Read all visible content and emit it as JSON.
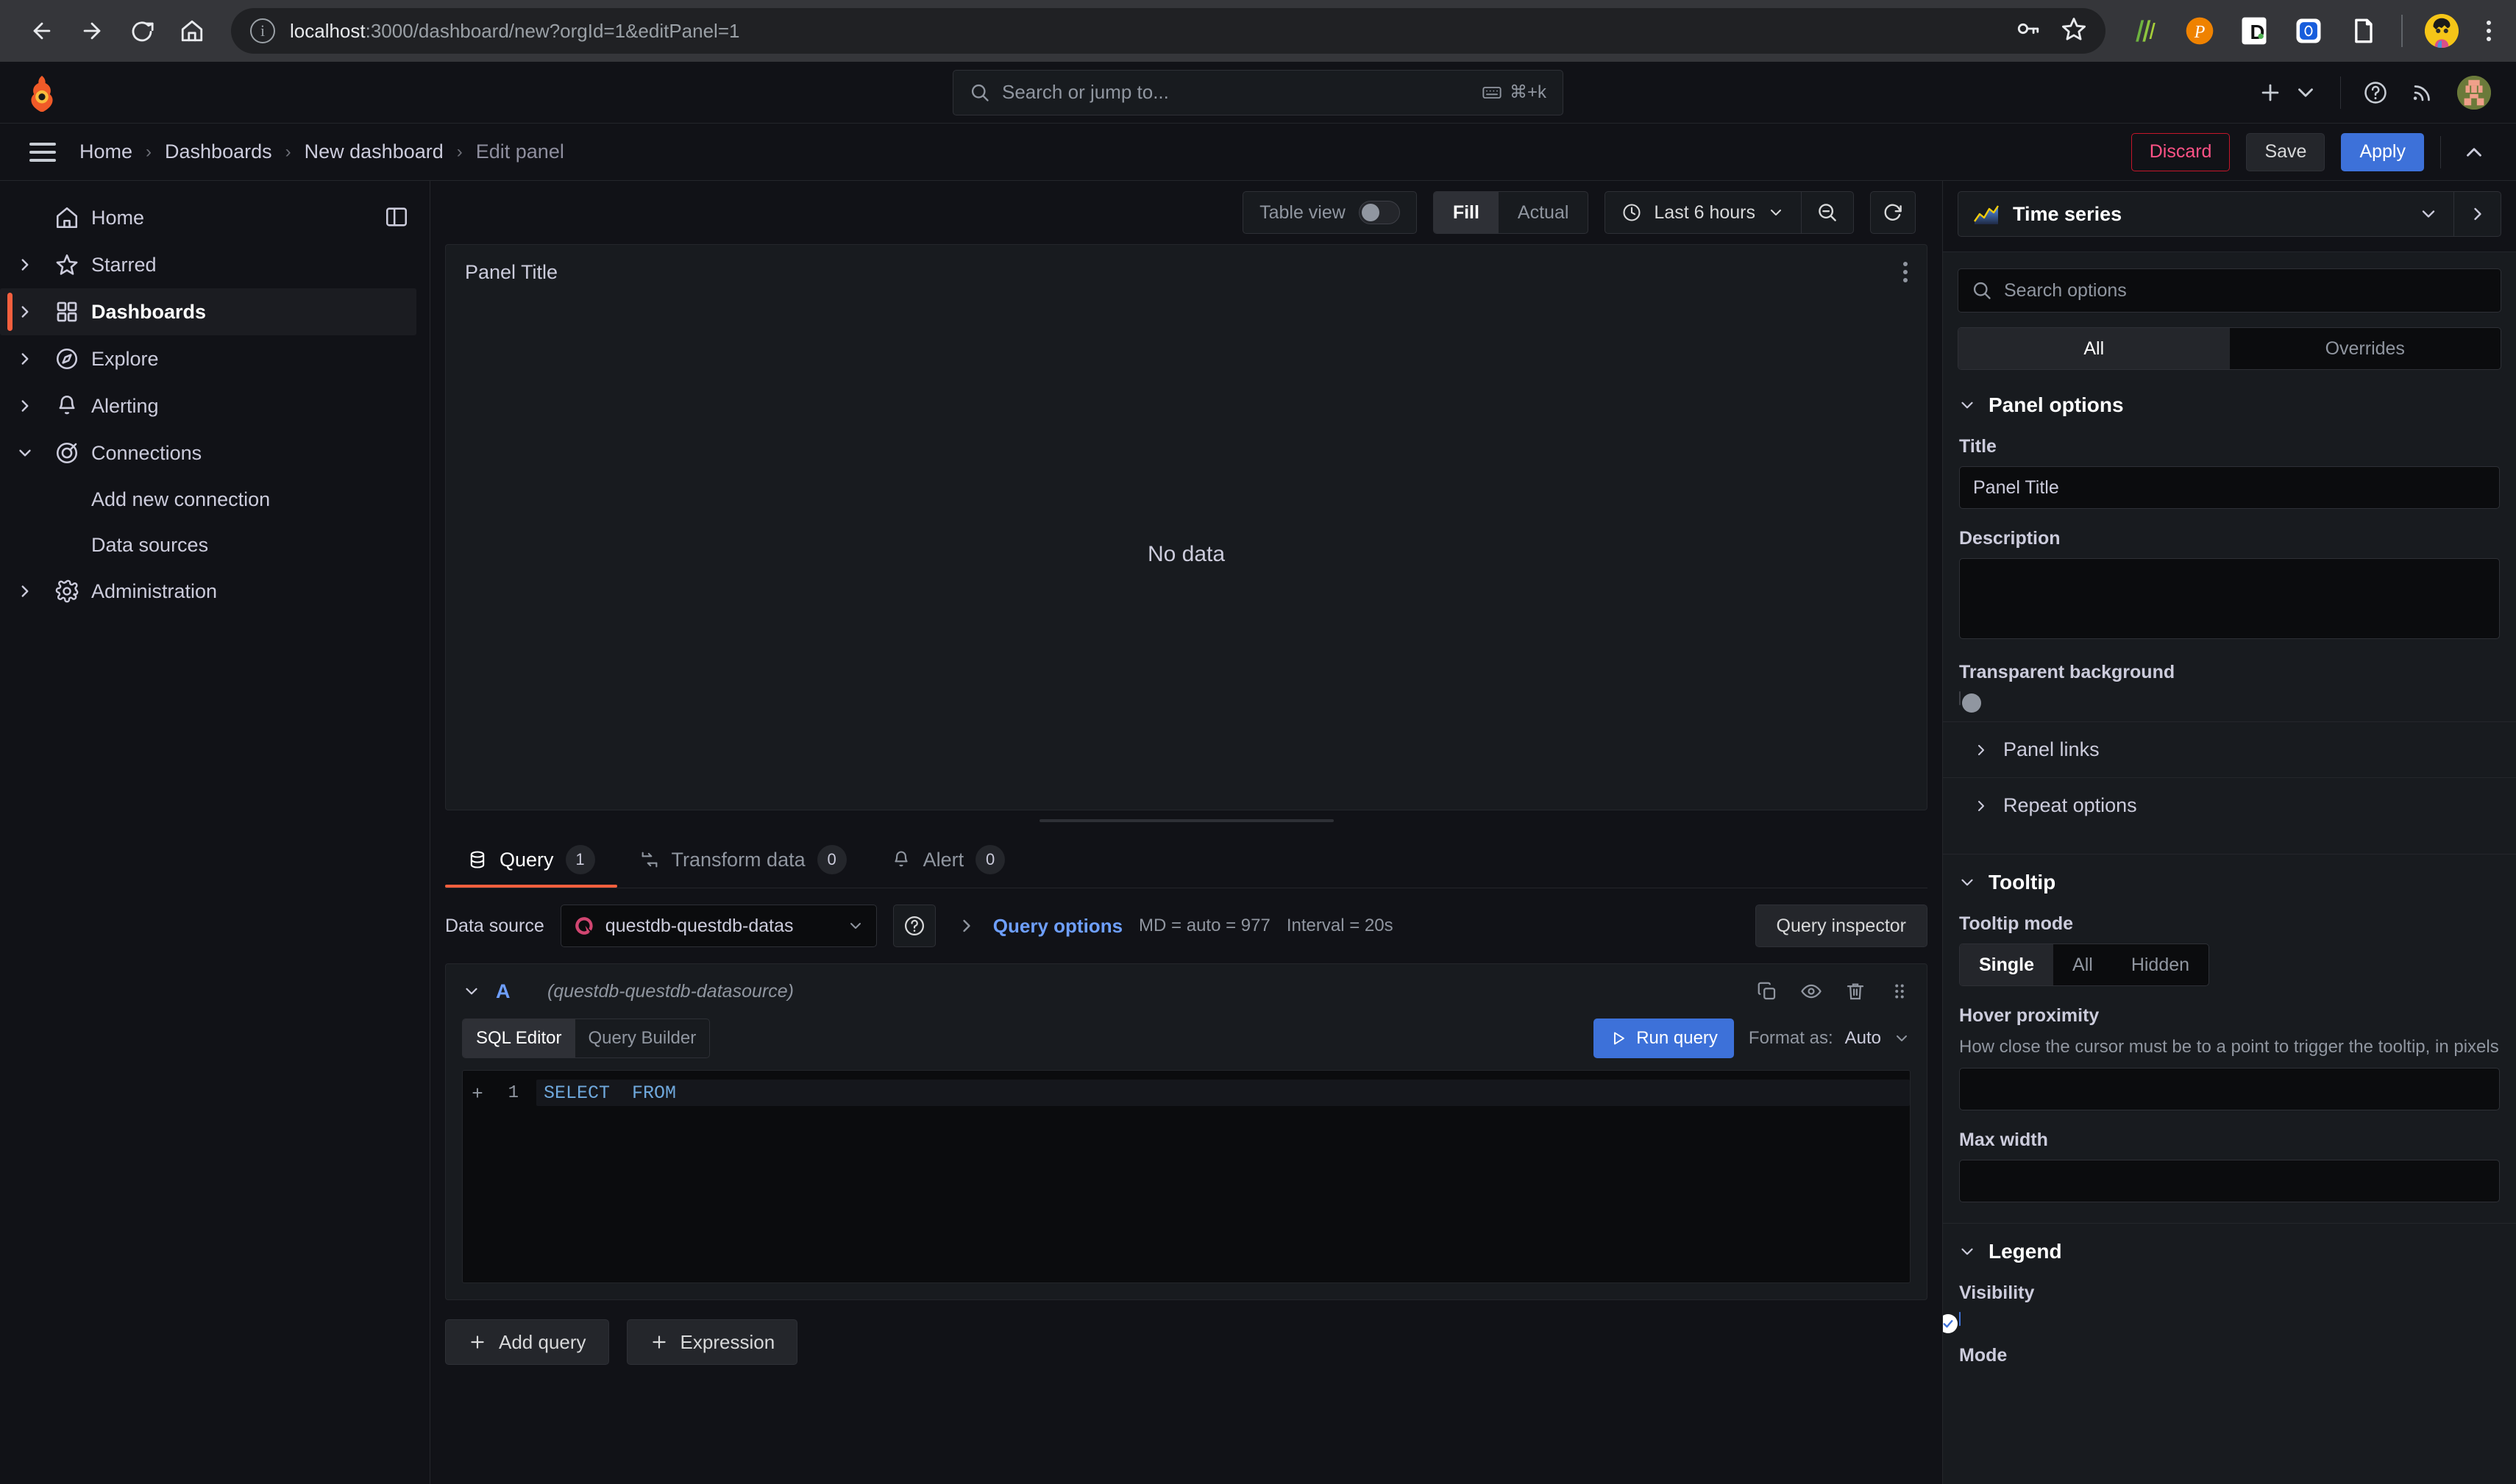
{
  "browser": {
    "back_icon": "back-arrow-icon",
    "forward_icon": "forward-arrow-icon",
    "reload_icon": "reload-icon",
    "home_icon": "home-icon",
    "url_host": "localhost",
    "url_path": ":3000/dashboard/new?orgId=1&editPanel=1",
    "passwords_icon": "key-icon",
    "bookmark_icon": "star-icon",
    "extensions": [
      "grammarly-icon",
      "pocket-icon",
      "dashlane-icon",
      "bitwarden-icon",
      "clipboard-icon"
    ],
    "profile_icon": "browser-profile-avatar",
    "menu_icon": "kebab-menu-icon"
  },
  "topnav": {
    "logo": "grafana-logo-icon",
    "search_placeholder": "Search or jump to...",
    "search_icon": "search-icon",
    "kbd_icon": "keyboard-icon",
    "kbd_shortcut": "⌘+k",
    "add_icon": "plus-icon",
    "add_caret_icon": "chevron-down-icon",
    "help_icon": "help-circle-icon",
    "news_icon": "rss-icon",
    "profile_icon": "user-avatar"
  },
  "breadcrumb": {
    "menu_icon": "hamburger-menu-icon",
    "items": [
      {
        "label": "Home",
        "current": false
      },
      {
        "label": "Dashboards",
        "current": false
      },
      {
        "label": "New dashboard",
        "current": false
      },
      {
        "label": "Edit panel",
        "current": true
      }
    ],
    "separator": "›",
    "discard_label": "Discard",
    "save_label": "Save",
    "apply_label": "Apply",
    "collapse_icon": "chevron-up-icon"
  },
  "sidebar": {
    "dock_icon": "dock-menu-icon",
    "items": [
      {
        "label": "Home",
        "icon": "home-icon",
        "expandable": false,
        "active": false,
        "child": false
      },
      {
        "label": "Starred",
        "icon": "star-icon",
        "expandable": true,
        "expanded": false,
        "active": false,
        "child": false
      },
      {
        "label": "Dashboards",
        "icon": "dashboards-grid-icon",
        "expandable": true,
        "expanded": false,
        "active": true,
        "child": false
      },
      {
        "label": "Explore",
        "icon": "compass-icon",
        "expandable": true,
        "expanded": false,
        "active": false,
        "child": false
      },
      {
        "label": "Alerting",
        "icon": "bell-icon",
        "expandable": true,
        "expanded": false,
        "active": false,
        "child": false
      },
      {
        "label": "Connections",
        "icon": "connections-icon",
        "expandable": true,
        "expanded": true,
        "active": false,
        "child": false
      },
      {
        "label": "Add new connection",
        "icon": "",
        "expandable": false,
        "active": false,
        "child": true
      },
      {
        "label": "Data sources",
        "icon": "",
        "expandable": false,
        "active": false,
        "child": true
      },
      {
        "label": "Administration",
        "icon": "gear-icon",
        "expandable": true,
        "expanded": false,
        "active": false,
        "child": false
      }
    ]
  },
  "panel_toolbar": {
    "table_view_label": "Table view",
    "table_view_on": false,
    "fill_label": "Fill",
    "actual_label": "Actual",
    "fill_selected": true,
    "time_icon": "clock-icon",
    "time_range": "Last 6 hours",
    "time_caret_icon": "chevron-down-icon",
    "zoom_out_icon": "zoom-out-icon",
    "refresh_icon": "refresh-icon"
  },
  "viz_panel": {
    "title": "Panel Title",
    "menu_icon": "panel-menu-icon",
    "no_data_text": "No data"
  },
  "query_tabs": [
    {
      "label": "Query",
      "count": "1",
      "icon": "database-icon",
      "selected": true
    },
    {
      "label": "Transform data",
      "count": "0",
      "icon": "transform-icon",
      "selected": false
    },
    {
      "label": "Alert",
      "count": "0",
      "icon": "bell-icon",
      "selected": false
    }
  ],
  "datasource_row": {
    "label": "Data source",
    "selected": "questdb-questdb-datas",
    "logo_icon": "questdb-logo-icon",
    "caret_icon": "chevron-down-icon",
    "help_icon": "help-circle-icon",
    "expand_icon": "chevron-right-icon",
    "query_options_label": "Query options",
    "md_info": "MD = auto = 977",
    "interval_info": "Interval = 20s",
    "query_inspector_label": "Query inspector"
  },
  "query_editor": {
    "collapse_icon": "chevron-down-icon",
    "ref_id": "A",
    "datasource_ref": "(questdb-questdb-datasource)",
    "actions": [
      "duplicate-query-icon",
      "hide-response-icon",
      "remove-query-icon",
      "drag-handle-icon"
    ],
    "sql_editor_tab": "SQL Editor",
    "query_builder_tab": "Query Builder",
    "active_editor_tab": "SQL Editor",
    "run_query_label": "Run query",
    "run_icon": "play-icon",
    "format_as_label": "Format as:",
    "format_as_value": "Auto",
    "format_caret_icon": "chevron-down-icon",
    "line_number": "1",
    "fold_icon": "expand-code-icon",
    "sql_keyword_1": "SELECT",
    "sql_keyword_2": "FROM"
  },
  "query_footer": {
    "add_query_label": "Add query",
    "expression_label": "Expression",
    "plus_icon": "plus-icon"
  },
  "options_pane": {
    "viz_name": "Time series",
    "viz_icon": "time-series-chart-icon",
    "viz_caret_icon": "chevron-down-icon",
    "viz_next_icon": "chevron-right-icon",
    "search_placeholder": "Search options",
    "search_icon": "search-icon",
    "tab_all": "All",
    "tab_overrides": "Overrides",
    "active_tab": "All",
    "sections": {
      "panel_options": {
        "title": "Panel options",
        "caret_icon": "chevron-down-icon",
        "title_label": "Title",
        "title_value": "Panel Title",
        "description_label": "Description",
        "description_value": "",
        "transparent_label": "Transparent background",
        "transparent_on": false,
        "panel_links_label": "Panel links",
        "repeat_options_label": "Repeat options",
        "sub_caret_icon": "chevron-right-icon"
      },
      "tooltip": {
        "title": "Tooltip",
        "caret_icon": "chevron-down-icon",
        "mode_label": "Tooltip mode",
        "mode_options": [
          "Single",
          "All",
          "Hidden"
        ],
        "mode_selected": "Single",
        "hover_label": "Hover proximity",
        "hover_desc": "How close the cursor must be to a point to trigger the tooltip, in pixels",
        "hover_value": "",
        "max_width_label": "Max width",
        "max_width_value": ""
      },
      "legend": {
        "title": "Legend",
        "caret_icon": "chevron-down-icon",
        "visibility_label": "Visibility",
        "visibility_on": true,
        "mode_label": "Mode"
      }
    }
  }
}
